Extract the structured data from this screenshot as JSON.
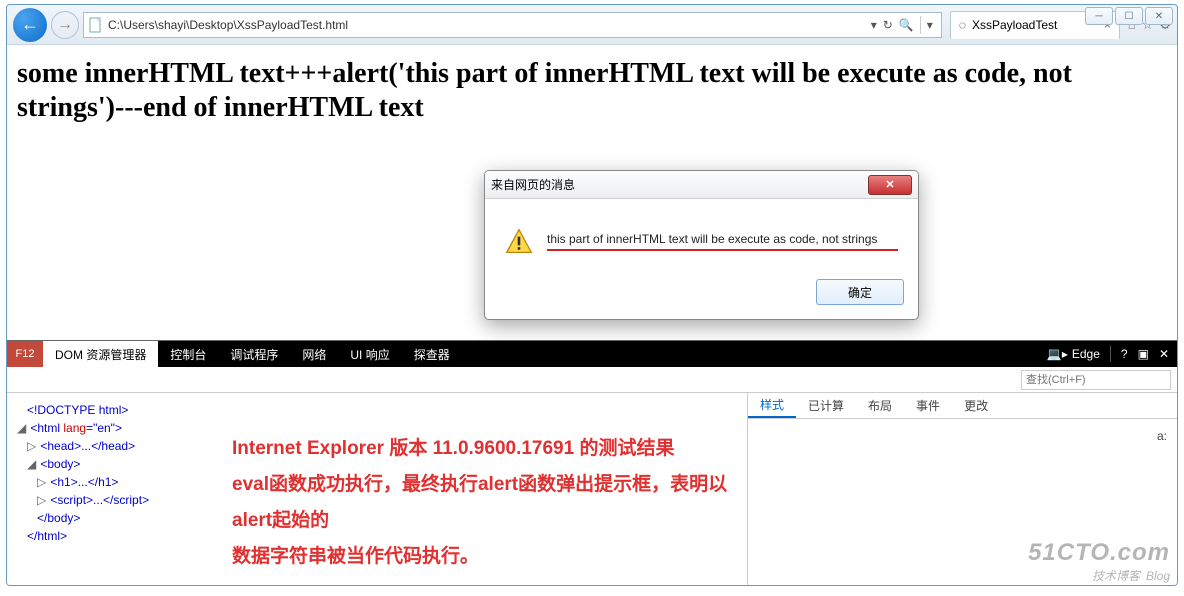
{
  "window": {
    "minimize": "─",
    "maximize": "☐",
    "close": "✕"
  },
  "nav": {
    "url": "C:\\Users\\shayi\\Desktop\\XssPayloadTest.html",
    "search_symbol": "🔍",
    "stop_symbol": "✖",
    "refresh_symbol": "↻"
  },
  "tab": {
    "title": "XssPayloadTest",
    "icons": {
      "home": "⌂",
      "star": "☆",
      "gear": "⚙"
    }
  },
  "page": {
    "heading": "some innerHTML text+++alert('this part of innerHTML text will be execute as code, not strings')---end of innerHTML text"
  },
  "alert": {
    "title": "来自网页的消息",
    "message": "this part of innerHTML text will be execute as code, not strings",
    "ok": "确定"
  },
  "devtools": {
    "f12": "F12",
    "tabs": [
      "DOM 资源管理器",
      "控制台",
      "调试程序",
      "网络",
      "UI 响应",
      "探查器"
    ],
    "right": {
      "edge": "Edge",
      "help": "?",
      "pin": "▣",
      "close": "✕"
    },
    "search_placeholder": "查找(Ctrl+F)",
    "style_tabs": [
      "样式",
      "已计算",
      "布局",
      "事件",
      "更改"
    ],
    "style_sel": "a:",
    "dom": {
      "l1": "<!DOCTYPE html>",
      "l2a": "<html ",
      "l2b": "lang",
      "l2c": "=",
      "l2d": "\"en\"",
      "l2e": ">",
      "l3": "<head>...</head>",
      "l4": "<body>",
      "l5": "<h1>...</h1>",
      "l6": "<script>...</scr",
      "l6b": "ipt>",
      "l7": "</body>",
      "l8": "</html>"
    }
  },
  "annotation": {
    "line1": "Internet Explorer 版本 11.0.9600.17691 的测试结果",
    "line2": "eval函数成功执行，最终执行alert函数弹出提示框，表明以alert起始的",
    "line3": "数据字符串被当作代码执行。"
  },
  "watermark": {
    "l1": "51CTO.com",
    "l2a": "技术博客",
    "l2b": "Blog"
  }
}
